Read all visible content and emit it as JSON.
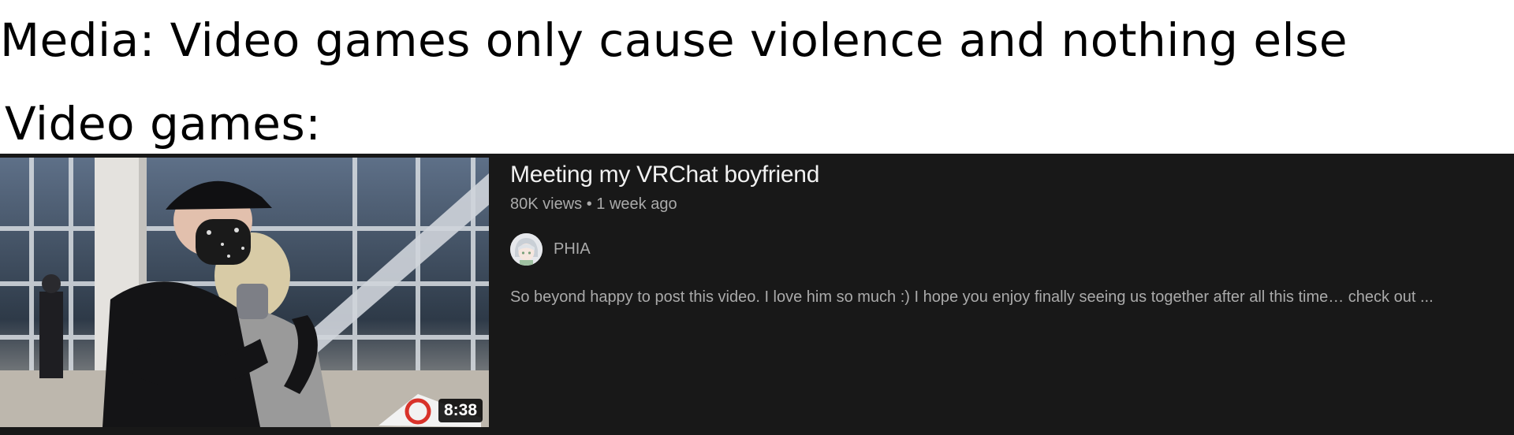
{
  "meme": {
    "line1": "Media: Video games only cause violence and nothing else",
    "line2": "Video games:"
  },
  "video": {
    "title": "Meeting my VRChat boyfriend",
    "meta": "80K views • 1 week ago",
    "channel": "PHIA",
    "description": "So beyond happy to post this video. I love him so much :) I hope you enjoy finally seeing us together after all this time… check out ...",
    "duration": "8:38"
  },
  "colors": {
    "page_bg": "#ffffff",
    "card_bg": "#181818",
    "title_text": "#f1f1f1",
    "secondary_text": "#aaaaaa"
  }
}
